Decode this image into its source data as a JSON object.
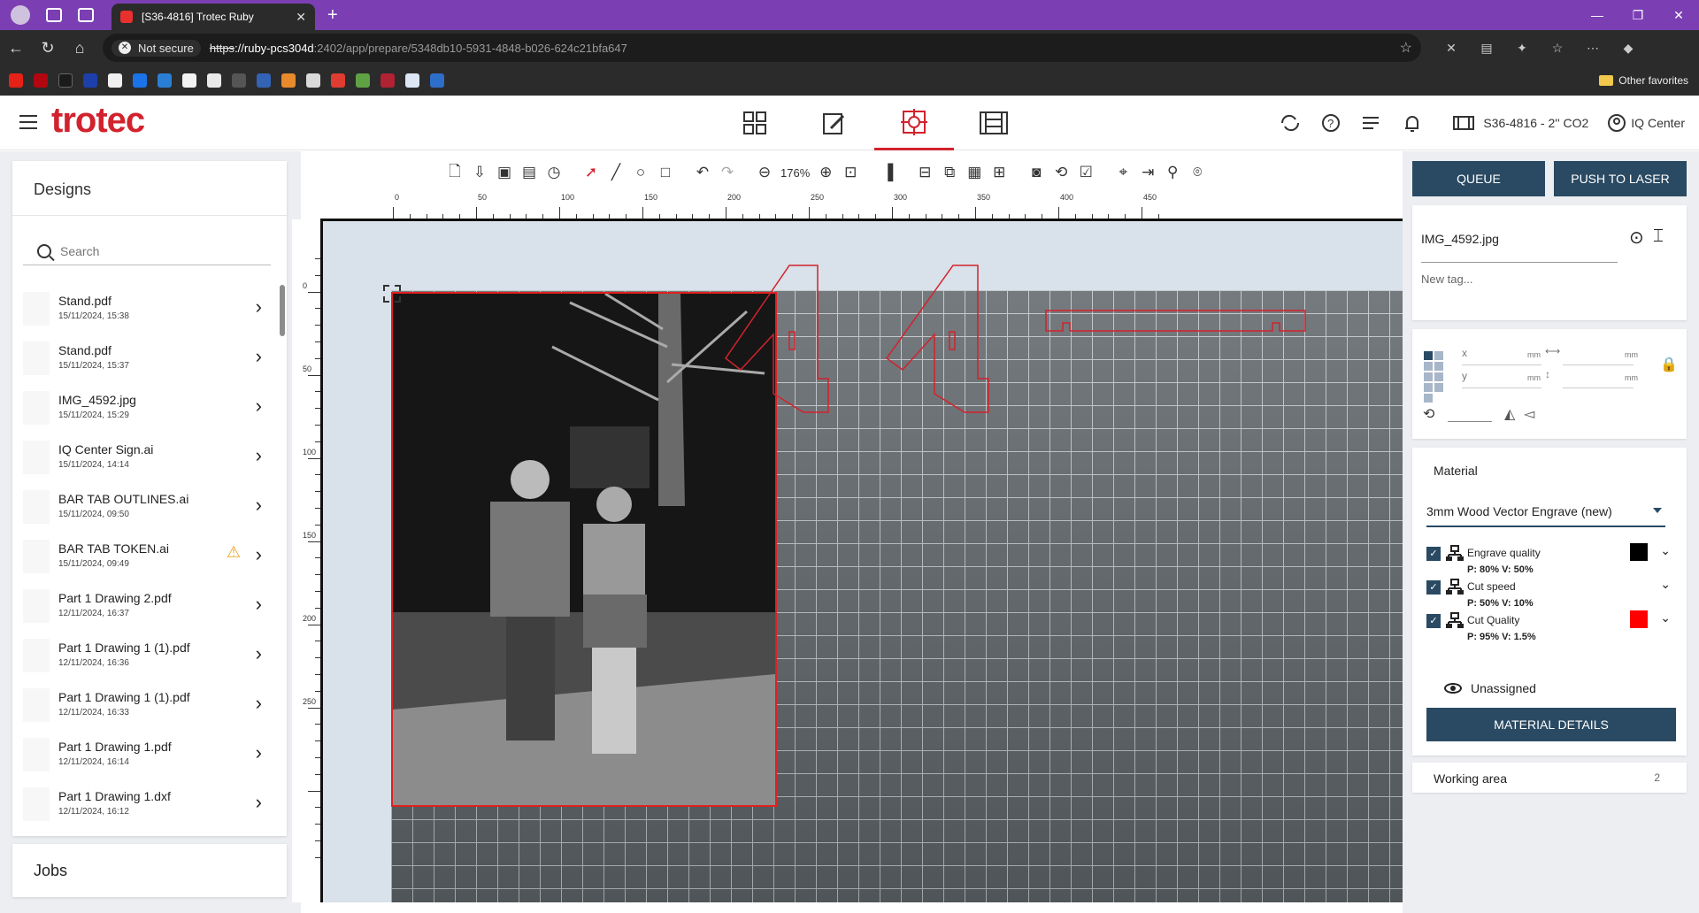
{
  "browser": {
    "tab_title": "[S36-4816] Trotec Ruby",
    "tab_close": "✕",
    "new_tab": "+",
    "window_controls": [
      "—",
      "❐",
      "✕"
    ],
    "security": "Not secure",
    "url_scheme": "https",
    "url_host": "://ruby-pcs304d",
    "url_path": ":2402/app/prepare/5348db10-5931-4848-b026-624c21bfa647",
    "other_favorites": "Other favorites"
  },
  "header": {
    "logo": "trotec",
    "machine": "S36-4816 - 2'' CO2",
    "iq_center": "IQ Center"
  },
  "designs": {
    "title": "Designs",
    "search_placeholder": "Search",
    "items": [
      {
        "name": "Stand.pdf",
        "date": "15/11/2024, 15:38",
        "warning": false
      },
      {
        "name": "Stand.pdf",
        "date": "15/11/2024, 15:37",
        "warning": false
      },
      {
        "name": "IMG_4592.jpg",
        "date": "15/11/2024, 15:29",
        "warning": false
      },
      {
        "name": "IQ Center Sign.ai",
        "date": "15/11/2024, 14:14",
        "warning": false
      },
      {
        "name": "BAR TAB OUTLINES.ai",
        "date": "15/11/2024, 09:50",
        "warning": false
      },
      {
        "name": "BAR TAB TOKEN.ai",
        "date": "15/11/2024, 09:49",
        "warning": true
      },
      {
        "name": "Part 1 Drawing 2.pdf",
        "date": "12/11/2024, 16:37",
        "warning": false
      },
      {
        "name": "Part 1 Drawing 1 (1).pdf",
        "date": "12/11/2024, 16:36",
        "warning": false
      },
      {
        "name": "Part 1 Drawing 1 (1).pdf",
        "date": "12/11/2024, 16:33",
        "warning": false
      },
      {
        "name": "Part 1 Drawing 1.pdf",
        "date": "12/11/2024, 16:14",
        "warning": false
      },
      {
        "name": "Part 1 Drawing 1.dxf",
        "date": "12/11/2024, 16:12",
        "warning": false
      }
    ]
  },
  "jobs": {
    "title": "Jobs"
  },
  "toolbar": {
    "zoom": "176%"
  },
  "rulers": {
    "top_labels": [
      "0",
      "50",
      "100",
      "150",
      "200",
      "250",
      "300",
      "350",
      "400",
      "450"
    ],
    "left_labels": [
      "0",
      "50",
      "100",
      "150",
      "200",
      "250"
    ]
  },
  "actions": {
    "queue": "QUEUE",
    "push": "PUSH TO LASER"
  },
  "properties": {
    "filename": "IMG_4592.jpg",
    "tag_placeholder": "New tag...",
    "x_label": "x",
    "y_label": "y",
    "unit": "mm"
  },
  "material": {
    "title": "Material",
    "selected": "3mm Wood Vector Engrave (new)",
    "params": [
      {
        "name": "Engrave quality",
        "values": "P: 80%   V: 50%",
        "color": "#000000"
      },
      {
        "name": "Cut speed",
        "values": "P: 50%   V: 10%",
        "color": ""
      },
      {
        "name": "Cut Quality",
        "values": "P: 95%   V: 1.5%",
        "color": "#ff0000"
      }
    ],
    "unassigned": "Unassigned",
    "details_button": "MATERIAL DETAILS"
  },
  "working_area": {
    "title": "Working area",
    "value": "2"
  },
  "colors": {
    "brand_red": "#d2222d",
    "primary": "#2a4a63",
    "chrome_purple": "#7b3fb3"
  }
}
